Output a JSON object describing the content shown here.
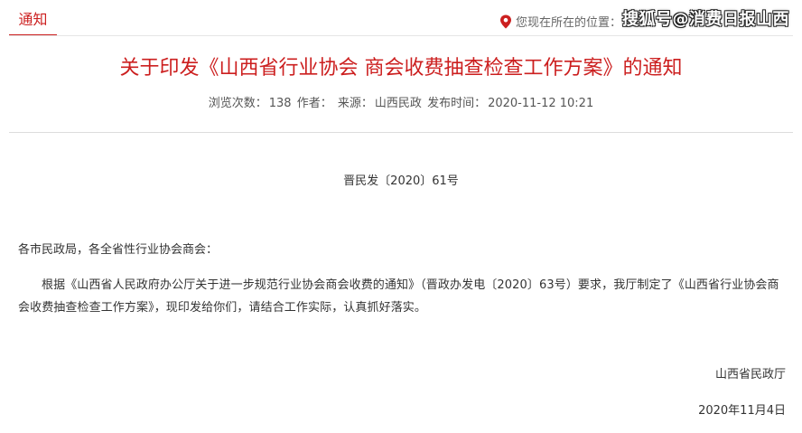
{
  "header": {
    "tab_label": "通知",
    "location_label": "您现在所在的位置：",
    "watermark": "搜狐号@消费日报山西"
  },
  "article": {
    "title": "关于印发《山西省行业协会 商会收费抽查检查工作方案》的通知",
    "meta": {
      "views_label": "浏览次数：",
      "views": "138",
      "author_label": "作者：",
      "source_label": "来源：",
      "source": "山西民政",
      "published_label": "发布时间：",
      "published": "2020-11-12 10:21"
    },
    "doc_number": "晋民发〔2020〕61号",
    "salutation": "各市民政局，各全省性行业协会商会：",
    "paragraph": "根据《山西省人民政府办公厅关于进一步规范行业协会商会收费的通知》（晋政办发电〔2020〕63号）要求，我厅制定了《山西省行业协会商会收费抽查检查工作方案》，现印发给你们，请结合工作实际，认真抓好落实。",
    "signer": "山西省民政厅",
    "date": "2020年11月4日"
  },
  "colors": {
    "accent": "#cc1f1f",
    "text": "#333333",
    "meta_text": "#555555"
  },
  "icons": {
    "location": "location-pin-icon"
  }
}
